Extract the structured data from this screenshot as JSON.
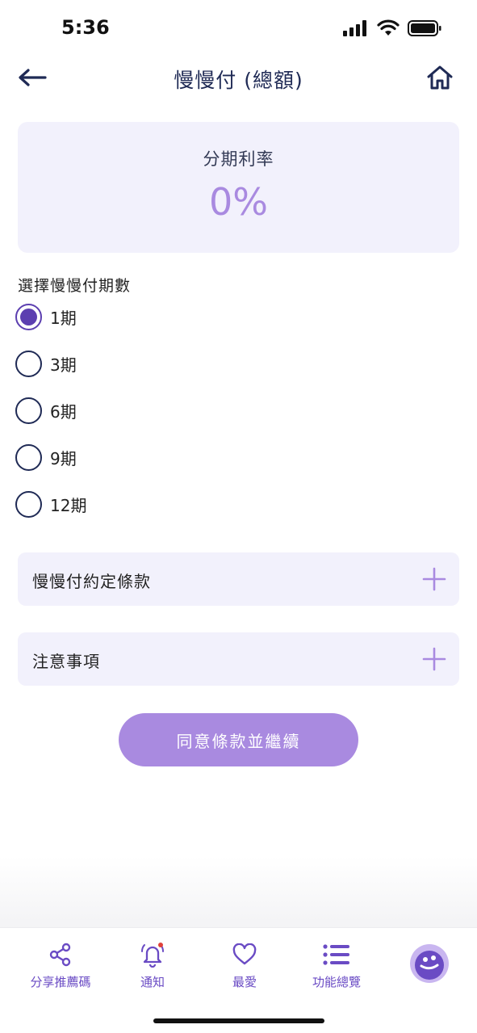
{
  "status_bar": {
    "time": "5:36"
  },
  "nav": {
    "title": "慢慢付 (總額)"
  },
  "rate_card": {
    "label": "分期利率",
    "value": "0%"
  },
  "installments": {
    "label": "選擇慢慢付期數",
    "options": [
      {
        "label": "1期",
        "selected": true
      },
      {
        "label": "3期",
        "selected": false
      },
      {
        "label": "6期",
        "selected": false
      },
      {
        "label": "9期",
        "selected": false
      },
      {
        "label": "12期",
        "selected": false
      }
    ]
  },
  "accordions": [
    {
      "label": "慢慢付約定條款"
    },
    {
      "label": "注意事項"
    }
  ],
  "cta": {
    "label": "同意條款並繼續"
  },
  "tab_bar": {
    "items": [
      {
        "label": "分享推薦碼",
        "icon": "share-icon"
      },
      {
        "label": "通知",
        "icon": "bell-icon"
      },
      {
        "label": "最愛",
        "icon": "heart-icon"
      },
      {
        "label": "功能總覽",
        "icon": "list-icon"
      }
    ]
  },
  "colors": {
    "accent": "#5c3fb0",
    "accent_light": "#a98ae0",
    "card_bg": "#f2f1fc",
    "navy": "#1f2a55",
    "notification_dot": "#e0413a"
  }
}
